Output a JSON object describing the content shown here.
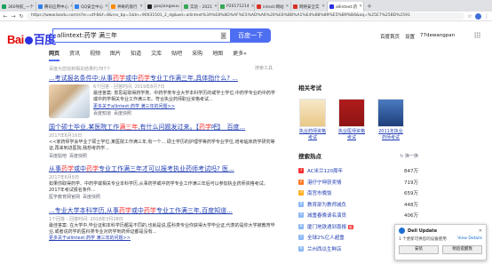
{
  "browser": {
    "tabs": [
      {
        "label": "360导航_一个",
        "color": "#19a15f"
      },
      {
        "label": "腾讯应用中心",
        "color": "#2f80ed"
      },
      {
        "label": "QQ安全中心",
        "color": "#2f80ed"
      },
      {
        "label": "神奇的旅行",
        "color": "#ff8a00"
      },
      {
        "label": "gaojiangwuu",
        "color": "#222222"
      },
      {
        "label": "实验 - 2021",
        "color": "#34a853"
      },
      {
        "label": "P20171214",
        "color": "#34a853"
      },
      {
        "label": "intext:网站",
        "color": "#d93025"
      },
      {
        "label": "网络安全实",
        "color": "#d93025"
      },
      {
        "label": "allintext:药",
        "color": "#2932e1"
      }
    ],
    "new_tab": "+",
    "url": "https://www.baidu.com/s?ie=utf-8&f=8&rsv_bp=1&tn=90031501_2_dg&wd=allintext%3A%E8%8D%AF%E5%AD%A6%20%E6%BB%A1%E4%B8%89%E5%B9%B4&oq=%25E7%25BD%2591"
  },
  "header": {
    "logo_bai": "Bai",
    "logo_du": "du",
    "logo_cn": "百度",
    "search_value": "allintext:药学 满三年",
    "search_button": "百度一下",
    "links": [
      "百度首页",
      "设置"
    ],
    "user": "77dewangpan"
  },
  "nav": {
    "tabs": [
      "网页",
      "资讯",
      "视频",
      "图片",
      "知道",
      "文库",
      "贴吧",
      "采购",
      "地图",
      "更多»"
    ],
    "tools": "搜索工具",
    "result_count": "百度为您找到相关结果约787个"
  },
  "results": [
    {
      "title_pre": "...考试报名条件中:从事",
      "title_em1": "药学",
      "title_mid": "或中",
      "title_em2": "药学",
      "title_post": "专业工作满三年,具体指什么? ...",
      "date": "6个回答 - 回答时间: 2019年8月7日",
      "snippet": "最佳答案: 意思是取得药学类、中药学类专业大学本科学历的或学士学位,中药学专业的中药学或中药学相关专业工作满三年。符合执业药师职业资格考试...",
      "more": "更多关于allintext:药学 满三年的问题>>",
      "source": "百度知道",
      "snapshot": "百度快照"
    },
    {
      "title_pre": "国个硕士毕业,某医院工作",
      "title_em1": "满三年",
      "title_mid": ",有什么问题发过来。【",
      "title_em2": "药学",
      "title_post": "吧】_百度...",
      "date": "2017年6月16日",
      "snippet": "<<家药师学会毕业了硕士学位,某医院工作满三年,有一个... 硕士学历的护理学等药学专业学位,增考临床药学研究等证,再来到进医院,我想考药学...",
      "more": "",
      "source": "百度贴吧",
      "snapshot": "百度快照"
    },
    {
      "title_pre": "从事",
      "title_em1": "药学",
      "title_mid": "或中",
      "title_em2": "药学",
      "title_post": "专业工作满三年才可以报考执业药师考试吗? 医...",
      "date": "2017年6月8日",
      "snippet": "如果你取得药学、中药学或相关专业本科学历,从事药学或中药学专业工作满三年后可以参加执业药师资格考试。 2017年考试报名条件... ",
      "more": "",
      "source": "医学教育网官网",
      "snapshot": "百度快照"
    },
    {
      "title_pre": "...专业大学本科学历,从事",
      "title_em1": "药学",
      "title_mid": "或中",
      "title_em2": "药学",
      "title_post": "专业工作满三年,百度知道...",
      "date": "1个回答 - 回答时间: 2018年3月28日",
      "snippet": "最佳答案: 在大学中,毕业证和本科学历都是不同的,也就是说,医科类专业你获得大学毕业证,代表的是你大学被教育毕业,或者说药学的医科类专业对药学到药师证都是没有...",
      "more": "更多关于allintext:药学 满三年的问题>>",
      "source": "",
      "snapshot": ""
    }
  ],
  "related": {
    "heading": "相关考试",
    "items": [
      {
        "caption": "执业药师资格考试"
      },
      {
        "caption": "执业医师资格考试"
      },
      {
        "caption": "2011年执业药师考试"
      }
    ]
  },
  "hot": {
    "heading": "搜索热点",
    "refresh": "换一换",
    "items": [
      {
        "rank": "1",
        "title": "AC米兰120周年",
        "badge": "",
        "value": "847万",
        "color": "#f73131"
      },
      {
        "rank": "2",
        "title": "港仔宁坤获奖情",
        "badge": "",
        "value": "719万",
        "color": "#ff7a26"
      },
      {
        "rank": "3",
        "title": "南宫市晚饭",
        "badge": "",
        "value": "659万",
        "color": "#ffb026"
      },
      {
        "rank": "4",
        "title": "教育部为教师减负",
        "badge": "",
        "value": "448万",
        "color": "#8eb9f5"
      },
      {
        "rank": "5",
        "title": "减重春晚请名演员",
        "badge": "",
        "value": "406万",
        "color": "#8eb9f5"
      },
      {
        "rank": "6",
        "title": "厦门地铁遇到喜报",
        "badge": "新",
        "value": "393万",
        "color": "#8eb9f5"
      },
      {
        "rank": "7",
        "title": "全球2%亿人超重",
        "badge": "",
        "value": "382万",
        "color": "#8eb9f5"
      },
      {
        "rank": "8",
        "title": "兰州西瓜生鲜店",
        "badge": "",
        "value": "",
        "color": "#8eb9f5"
      }
    ]
  },
  "popup": {
    "title": "Dell Update",
    "body": "1 个更新可供您的设备使用",
    "link": "View Details",
    "install": "安装",
    "later": "稍后提醒我"
  }
}
